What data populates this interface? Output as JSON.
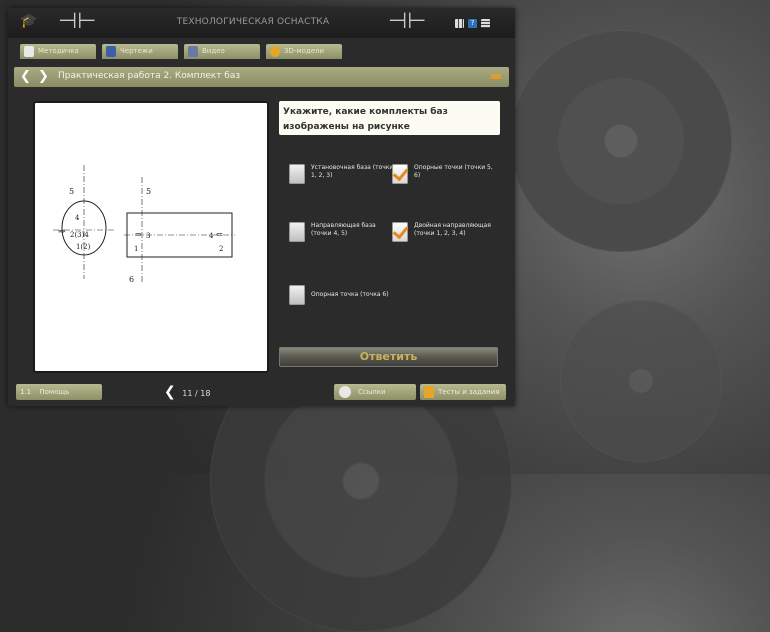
{
  "app": {
    "title": "ТЕХНОЛОГИЧЕСКАЯ ОСНАСТКА"
  },
  "icons": {
    "header_left": "graduation-cap-icon",
    "header_tool_left": "caliper-icon",
    "header_tool_right": "caliper-icon",
    "grid": "grid-icon",
    "help": "help-icon",
    "menu": "menu-icon",
    "help_mark": "?"
  },
  "tabs": [
    {
      "label": "Методичка",
      "icon": "book-icon"
    },
    {
      "label": "Чертежи",
      "icon": "document-icon"
    },
    {
      "label": "Видео",
      "icon": "film-icon"
    },
    {
      "label": "3D-модели",
      "icon": "model-icon"
    }
  ],
  "lesson": {
    "title": "Практическая работа 2. Комплект баз",
    "prev": "❮",
    "next": "❯"
  },
  "question": {
    "text": "Укажите, какие комплекты баз изображены на рисунке"
  },
  "options": [
    {
      "label": "Установочная база (точки 1, 2, 3)",
      "checked": false
    },
    {
      "label": "Опорные точки (точки 5, 6)",
      "checked": true
    },
    {
      "label": "Направляющая база (точки 4, 5)",
      "checked": false
    },
    {
      "label": "Двойная направляющая (точки 1, 2, 3, 4)",
      "checked": true
    },
    {
      "label": "Опорная точка (точка 6)",
      "checked": false
    }
  ],
  "drawing": {
    "labels": [
      "5",
      "5",
      "6",
      "4",
      "2(3)4",
      "1(2)",
      "3",
      "1",
      "4",
      "2",
      "6"
    ]
  },
  "answer_button": {
    "label": "Ответить"
  },
  "footer": {
    "help_number": "1.1",
    "help_label": "Помощь",
    "pager_prev": "❮",
    "pager_current": "11",
    "pager_total": "18",
    "refs_label": "Ссылки",
    "task_label": "Тесты и задания"
  },
  "colors": {
    "accent": "#e28a1e",
    "panel": "#a9ab83",
    "window": "#2b2b2b"
  }
}
